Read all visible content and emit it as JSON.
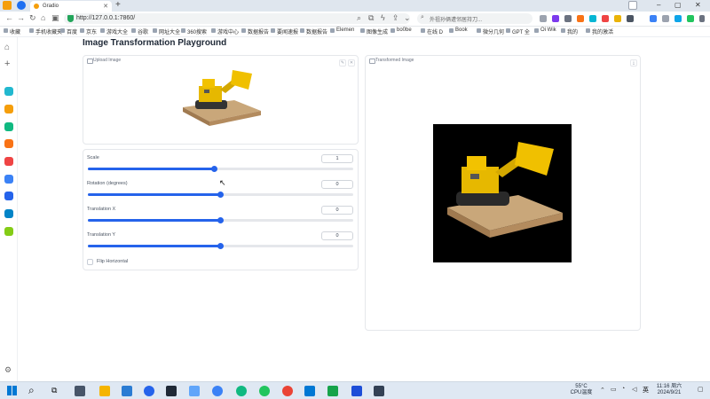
{
  "browser": {
    "tab_title": "Gradio",
    "url": "http://127.0.0.1:7860/",
    "search_placeholder": "外祖孙俩遭邻居持刀...",
    "bookmarks": [
      "收藏",
      "手机收藏夹",
      "百度",
      "京东",
      "游戏大全",
      "谷歌",
      "网址大全",
      "360搜索",
      "游戏中心",
      "数据报告",
      "要闻速报",
      "数据报告",
      "Elemen",
      "图像生成",
      "bo0be",
      "在线 D",
      "Book",
      "微分几何",
      "GPT 全",
      "Oi Wik",
      "我的",
      "我的激活"
    ]
  },
  "app": {
    "title": "Image Transformation Playground",
    "upload_label": "Upload Image",
    "output_label": "Transformed Image",
    "sliders": [
      {
        "label": "Scale",
        "value": "1",
        "fraction": 0.477
      },
      {
        "label": "Rotation (degrees)",
        "value": "0",
        "fraction": 0.5
      },
      {
        "label": "Translation X",
        "value": "0",
        "fraction": 0.5
      },
      {
        "label": "Translation Y",
        "value": "0",
        "fraction": 0.5
      }
    ],
    "flip_label": "Flip Horizontal",
    "flip_checked": false
  },
  "taskbar": {
    "weather_temp": "55°C",
    "weather_text": "CPU温度",
    "ime": "英",
    "time": "11:16 周六",
    "date": "2024/9/21"
  },
  "colors": {
    "accent": "#2563eb",
    "track": "#e5e7eb"
  },
  "icons": [
    "wechat-icon",
    "vivaldi-icon",
    "refresh-icon",
    "home-icon",
    "shield-icon",
    "search-icon",
    "star-icon",
    "windows-start-icon",
    "chrome-icon",
    "vscode-icon",
    "edge-icon"
  ]
}
